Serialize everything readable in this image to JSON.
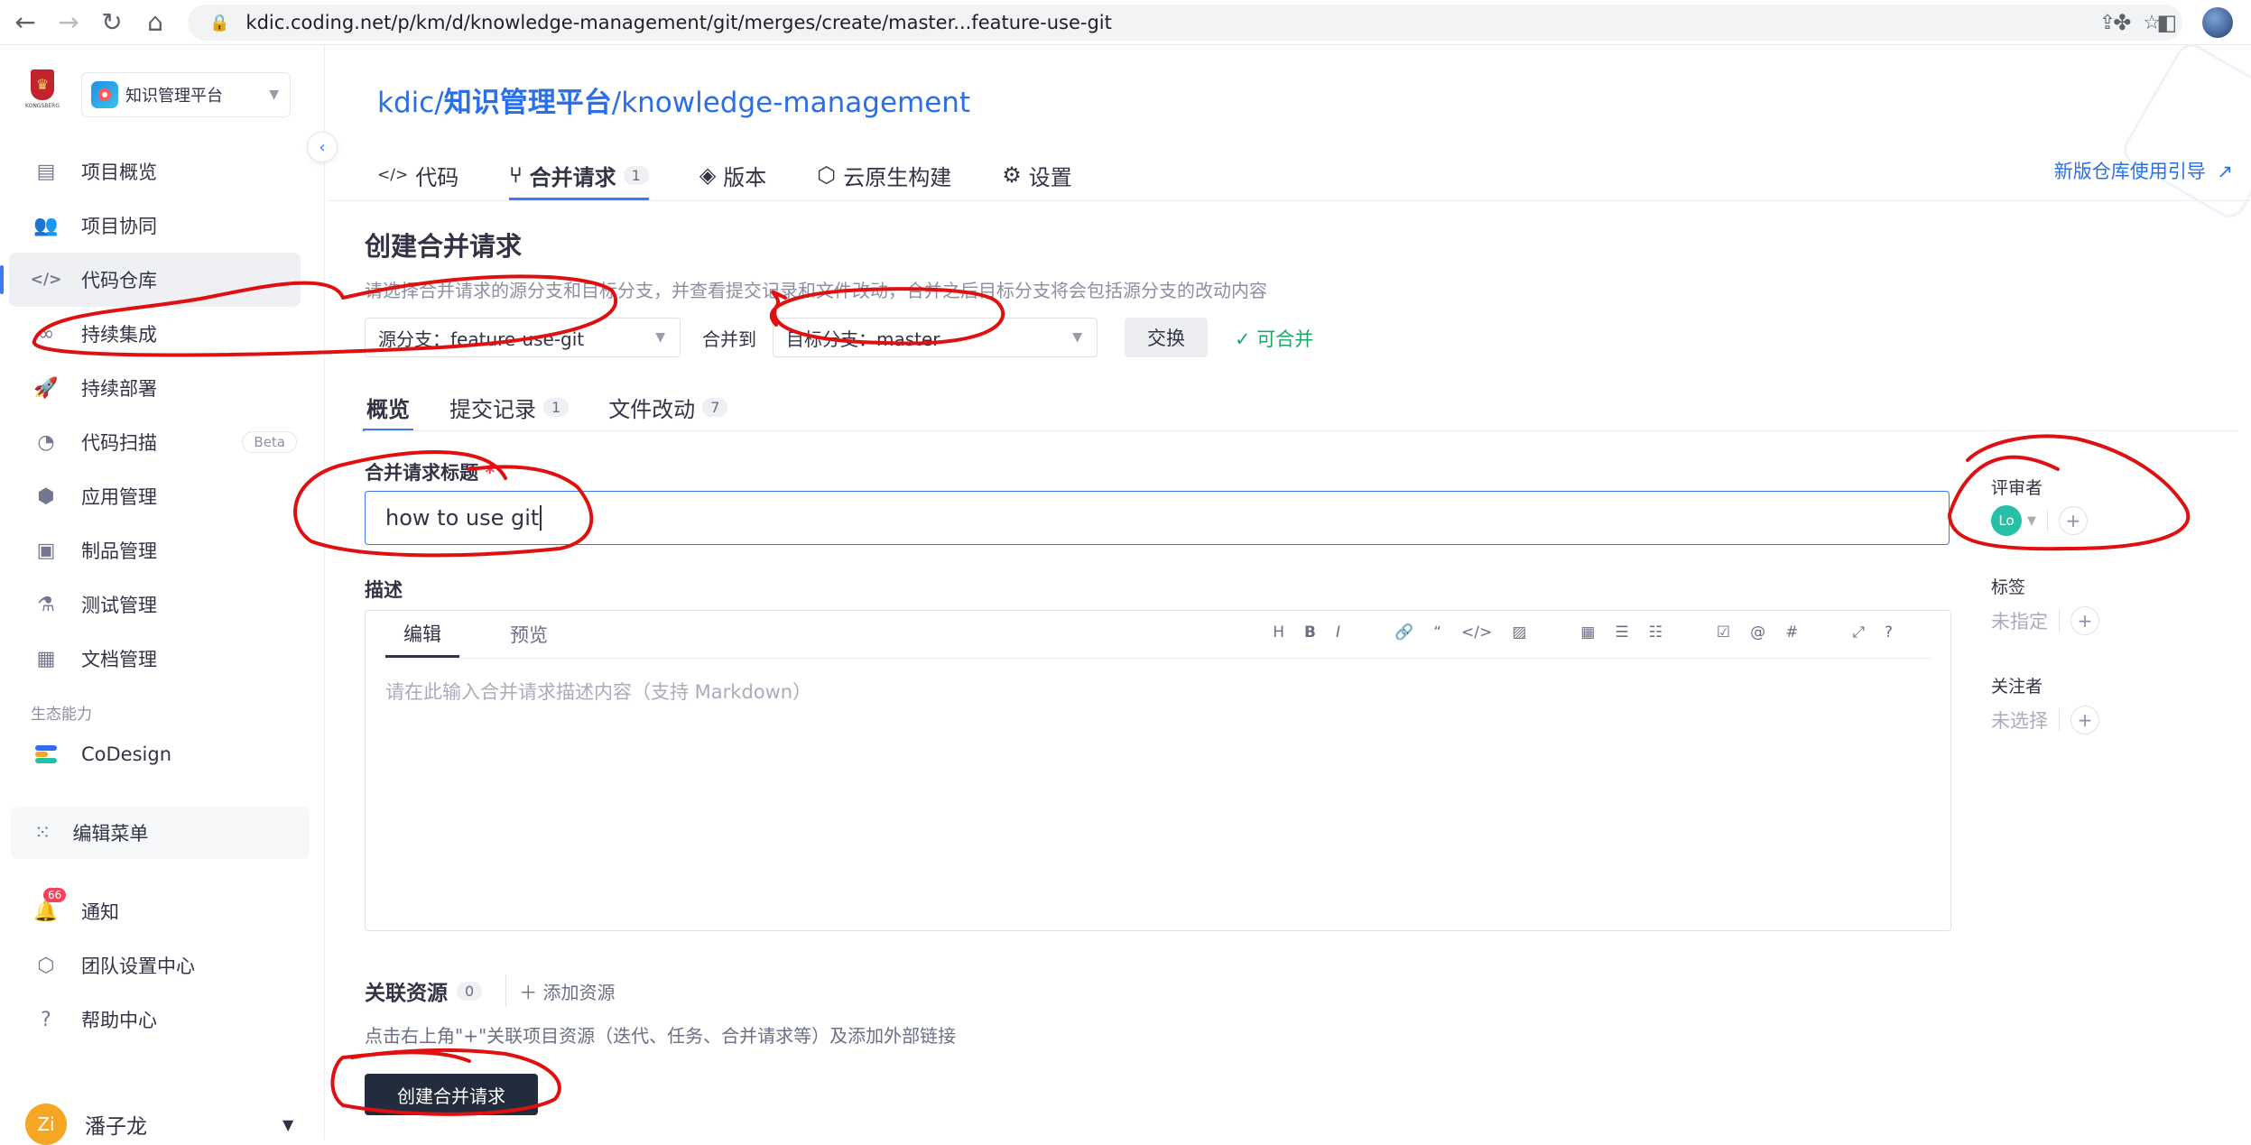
{
  "browser": {
    "url": "kdic.coding.net/p/km/d/knowledge-management/git/merges/create/master...feature-use-git"
  },
  "sidebar": {
    "project_name": "知识管理平台",
    "logo_text": "KONGSBERG",
    "items": [
      {
        "label": "项目概览",
        "icon": "overview-icon"
      },
      {
        "label": "项目协同",
        "icon": "users-icon"
      },
      {
        "label": "代码仓库",
        "icon": "code-icon"
      },
      {
        "label": "持续集成",
        "icon": "infinity-icon"
      },
      {
        "label": "持续部署",
        "icon": "rocket-icon"
      },
      {
        "label": "代码扫描",
        "icon": "scan-icon",
        "badge": "Beta"
      },
      {
        "label": "应用管理",
        "icon": "cube-icon"
      },
      {
        "label": "制品管理",
        "icon": "box-icon"
      },
      {
        "label": "测试管理",
        "icon": "flask-icon"
      },
      {
        "label": "文档管理",
        "icon": "doc-icon"
      }
    ],
    "section_label": "生态能力",
    "codesign_label": "CoDesign",
    "edit_menu_label": "编辑菜单",
    "notify_label": "通知",
    "notify_badge": "66",
    "team_settings_label": "团队设置中心",
    "help_label": "帮助中心",
    "user_initials": "Zi",
    "user_name": "潘子龙"
  },
  "header": {
    "crumb_team": "kdic",
    "crumb_project": "知识管理平台",
    "crumb_repo": "knowledge-management",
    "sep": "/",
    "tabs": [
      {
        "label": "代码",
        "icon": "</>"
      },
      {
        "label": "合并请求",
        "icon": "⑂",
        "count": "1"
      },
      {
        "label": "版本",
        "icon": "◈"
      },
      {
        "label": "云原生构建",
        "icon": "⬡"
      },
      {
        "label": "设置",
        "icon": "⚙"
      }
    ],
    "guide_link": "新版仓库使用引导"
  },
  "form": {
    "title": "创建合并请求",
    "description": "请选择合并请求的源分支和目标分支，并查看提交记录和文件改动，合并之后目标分支将会包括源分支的改动内容",
    "source_branch": "源分支：feature-use-git",
    "merge_to": "合并到",
    "target_branch": "目标分支：master",
    "swap_label": "交换",
    "mergeable_label": "可合并",
    "subtabs": [
      {
        "label": "概览"
      },
      {
        "label": "提交记录",
        "count": "1"
      },
      {
        "label": "文件改动",
        "count": "7"
      }
    ],
    "title_label": "合并请求标题",
    "required_mark": "*",
    "title_value": "how to use git",
    "desc_label": "描述",
    "editor_tab_edit": "编辑",
    "editor_tab_preview": "预览",
    "editor_placeholder": "请在此输入合并请求描述内容（支持 Markdown）",
    "related_label": "关联资源",
    "related_count": "0",
    "add_resource": "添加资源",
    "related_hint": "点击右上角\"+\"关联项目资源（迭代、任务、合并请求等）及添加外部链接",
    "create_button": "创建合并请求"
  },
  "side": {
    "reviewer_label": "评审者",
    "reviewer_initials": "Lo",
    "tag_label": "标签",
    "tag_value": "未指定",
    "watcher_label": "关注者",
    "watcher_value": "未选择"
  },
  "colors": {
    "accent": "#3e78f6",
    "annotation": "#e01010",
    "success": "#1ca764"
  }
}
